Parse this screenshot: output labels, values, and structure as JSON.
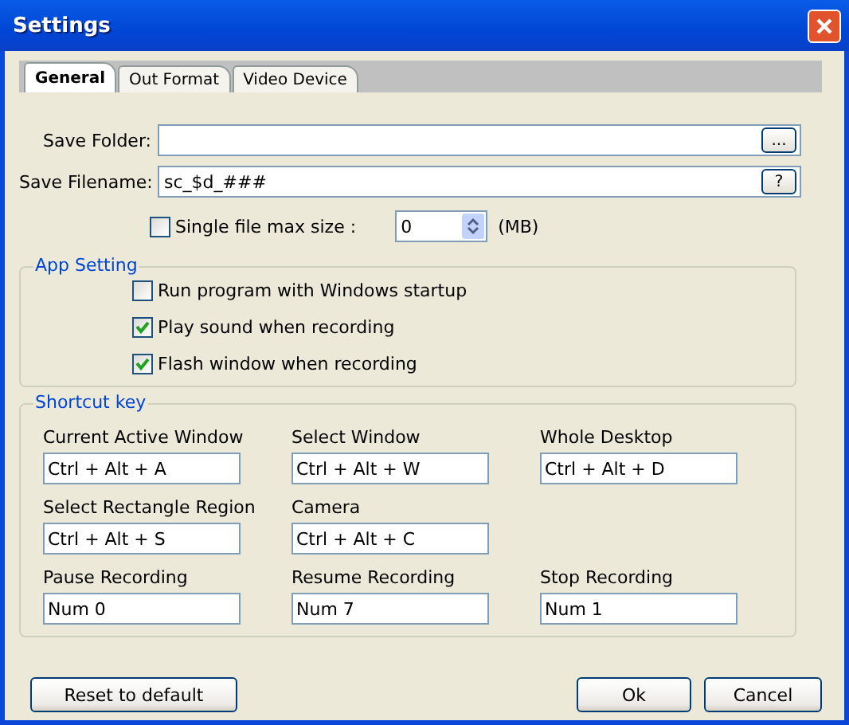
{
  "window": {
    "title": "Settings"
  },
  "tabs": [
    {
      "label": "General",
      "selected": true
    },
    {
      "label": "Out Format",
      "selected": false
    },
    {
      "label": "Video Device",
      "selected": false
    }
  ],
  "save_folder": {
    "label": "Save Folder:",
    "button": "..."
  },
  "save_filename": {
    "label": "Save Filename:",
    "value": "sc_$d_###",
    "button": "?"
  },
  "max_size": {
    "label": "Single file max size :",
    "checked": false,
    "value": "0",
    "unit": "(MB)"
  },
  "app_setting": {
    "title": "App Setting",
    "options": [
      {
        "label": "Run program with Windows startup",
        "checked": false
      },
      {
        "label": "Play sound when recording",
        "checked": true
      },
      {
        "label": "Flash window when recording",
        "checked": true
      }
    ]
  },
  "shortcut_key": {
    "title": "Shortcut key",
    "rows": [
      [
        {
          "label": "Current Active Window",
          "value": "Ctrl + Alt + A"
        },
        {
          "label": "Select Window",
          "value": "Ctrl + Alt + W"
        },
        {
          "label": "Whole Desktop",
          "value": "Ctrl + Alt + D"
        }
      ],
      [
        {
          "label": "Select Rectangle Region",
          "value": "Ctrl + Alt + S"
        },
        {
          "label": "Camera",
          "value": "Ctrl + Alt + C"
        }
      ],
      [
        {
          "label": "Pause Recording",
          "value": "Num 0"
        },
        {
          "label": "Resume Recording",
          "value": "Num 7"
        },
        {
          "label": "Stop Recording",
          "value": "Num 1"
        }
      ]
    ]
  },
  "buttons": {
    "reset": "Reset to default",
    "ok": "Ok",
    "cancel": "Cancel"
  }
}
